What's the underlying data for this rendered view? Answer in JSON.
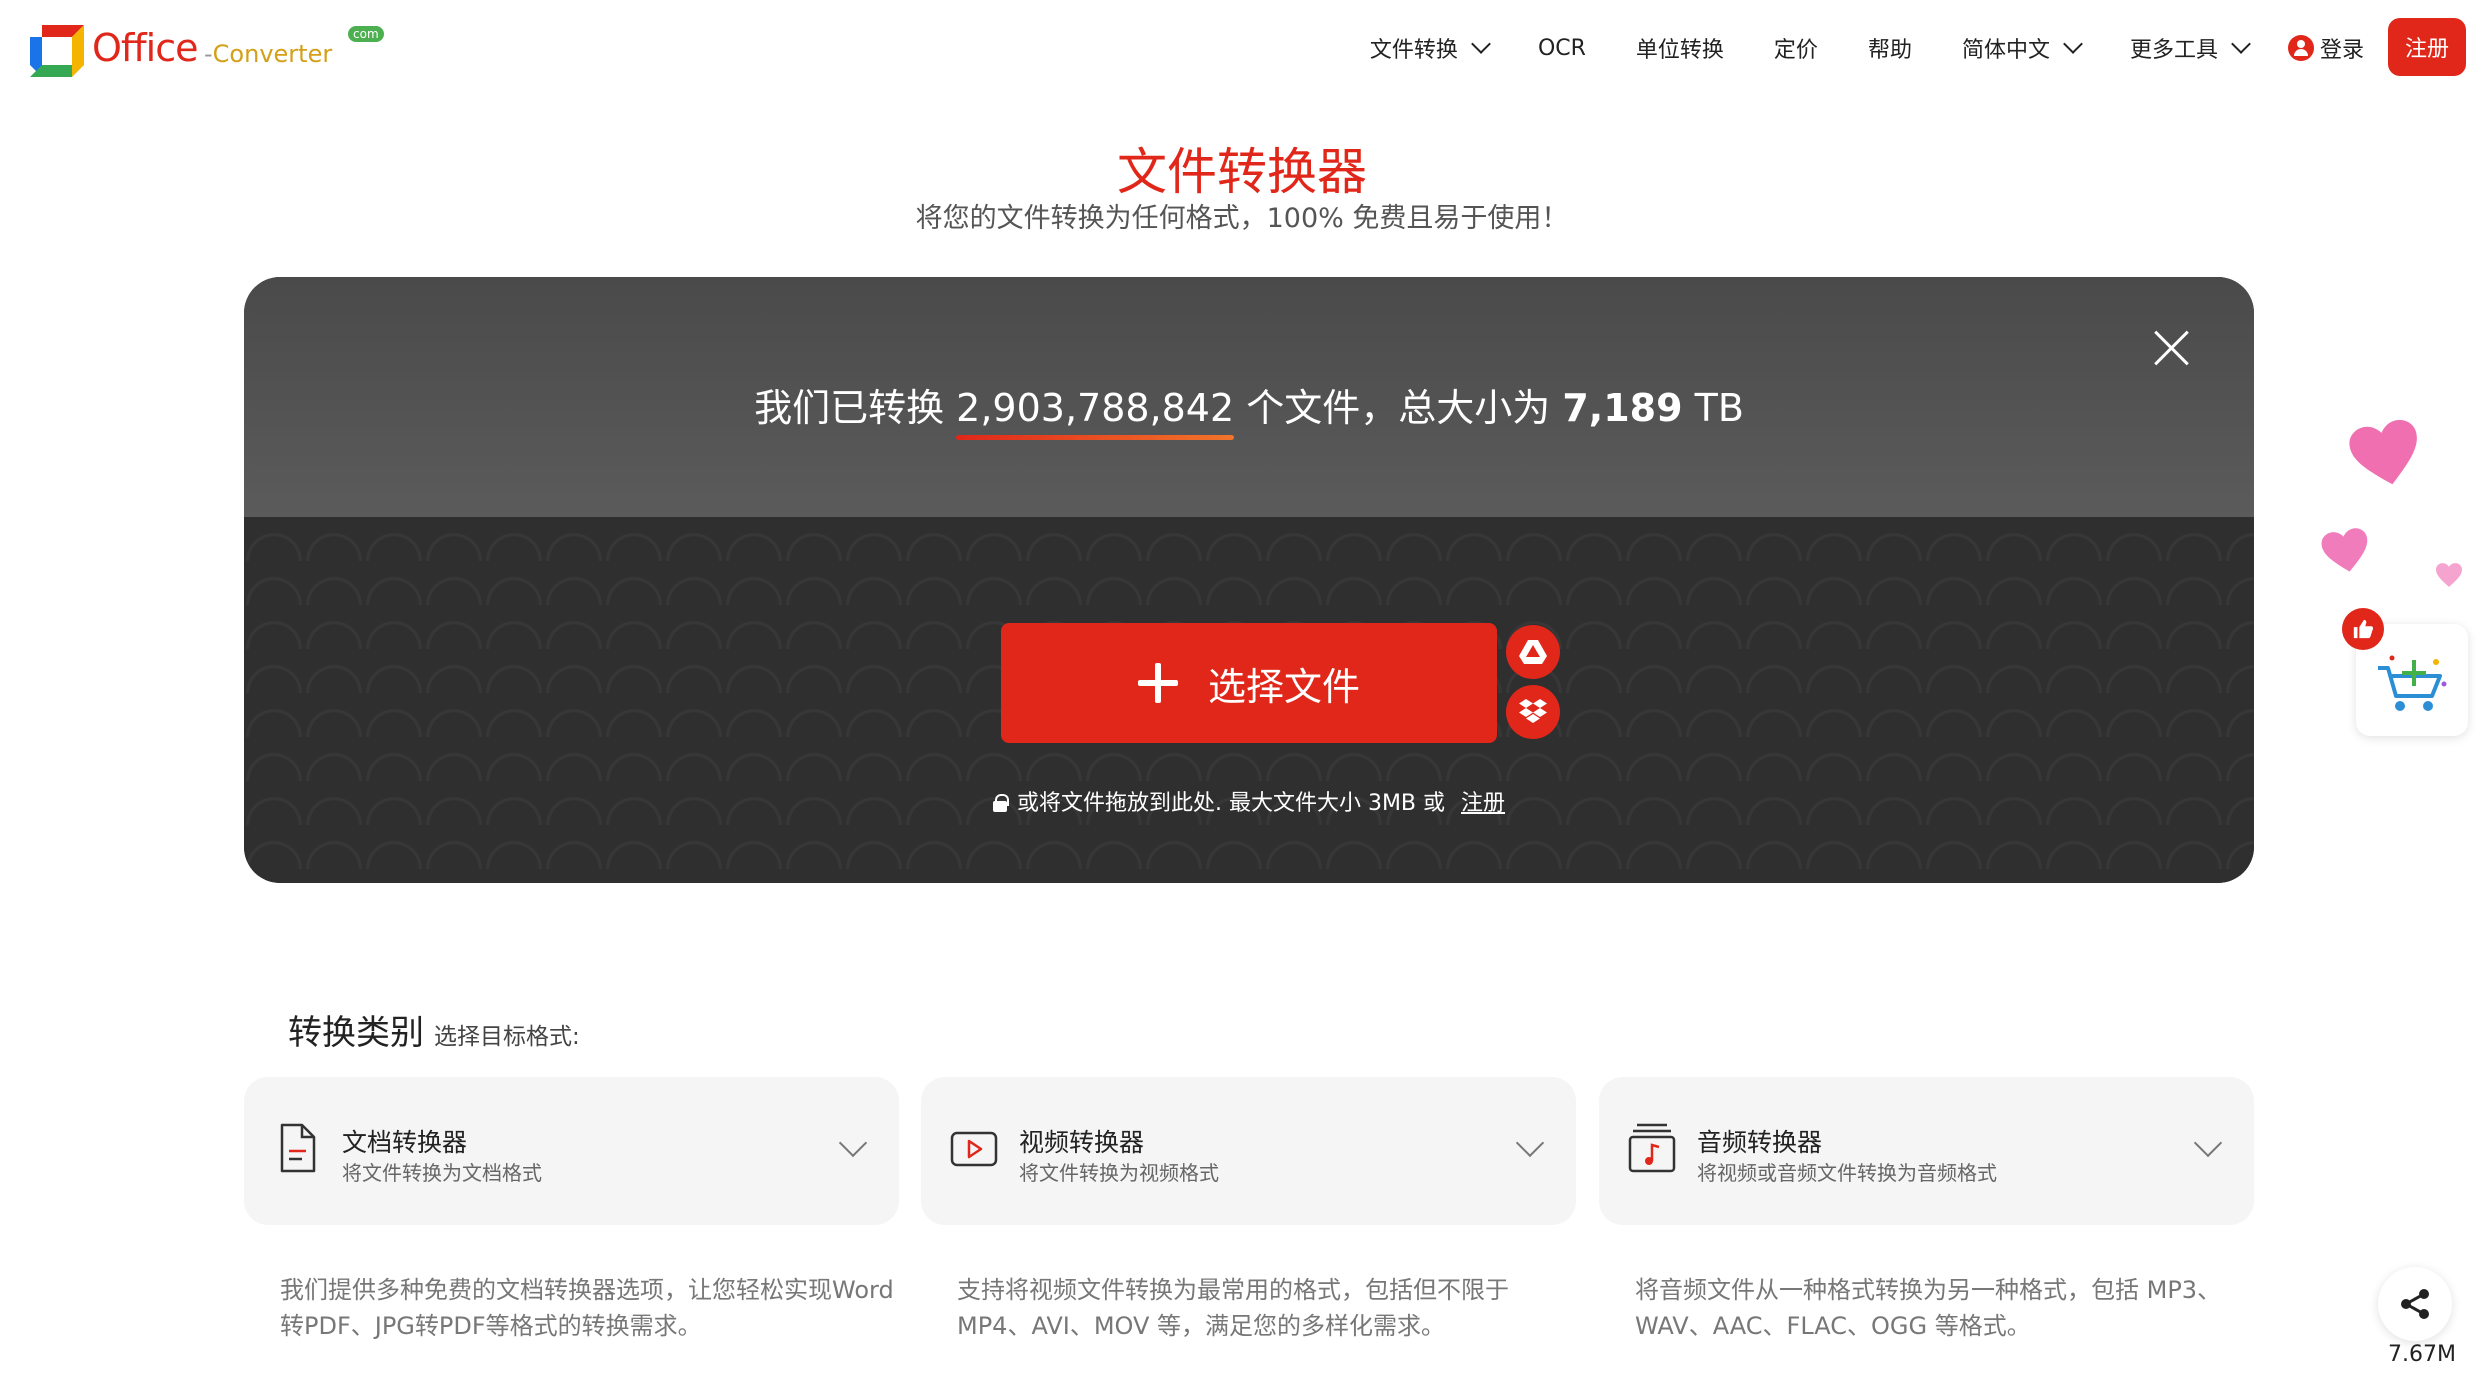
{
  "header": {
    "logo": {
      "brand": "Office",
      "product": "Converter",
      "badge": "com"
    },
    "nav": [
      {
        "label": "文件转换",
        "icon": "chevron-down-icon"
      },
      {
        "label": "OCR"
      },
      {
        "label": "单位转换"
      },
      {
        "label": "定价"
      },
      {
        "label": "帮助"
      },
      {
        "label": "简体中文",
        "icon": "chevron-down-icon"
      },
      {
        "label": "更多工具",
        "icon": "chevron-down-icon"
      }
    ],
    "login_label": "登录",
    "signup_label": "注册"
  },
  "hero": {
    "title": "文件转换器",
    "subtitle": "将您的文件转换为任何格式，100% 免费且易于使用！"
  },
  "upload": {
    "stats_prefix": "我们已转换 ",
    "files_count": "2,903,788,842",
    "stats_middle": " 个文件，总大小为 ",
    "total_size": "7,189",
    "size_unit": " TB",
    "choose_label": "选择文件",
    "drop_note": "或将文件拖放到此处. 最大文件大小 3MB 或",
    "drop_register": "注册"
  },
  "floating": {
    "share_size": "7.67M"
  },
  "categories": {
    "title": "转换类别",
    "subtitle": "选择目标格式:",
    "items": [
      {
        "name": "文档转换器",
        "desc": "将文件转换为文档格式",
        "icon": "document-icon",
        "detail": "我们提供多种免费的文档转换器选项，让您轻松实现Word转PDF、JPG转PDF等格式的转换需求。"
      },
      {
        "name": "视频转换器",
        "desc": "将文件转换为视频格式",
        "icon": "video-icon",
        "detail": "支持将视频文件转换为最常用的格式，包括但不限于MP4、AVI、MOV 等，满足您的多样化需求。"
      },
      {
        "name": "音频转换器",
        "desc": "将视频或音频文件转换为音频格式",
        "icon": "audio-icon",
        "detail": "将音频文件从一种格式转换为另一种格式，包括 MP3、WAV、AAC、FLAC、OGG 等格式。"
      }
    ]
  },
  "colors": {
    "accent": "#e0271a",
    "panel": "#333333"
  }
}
